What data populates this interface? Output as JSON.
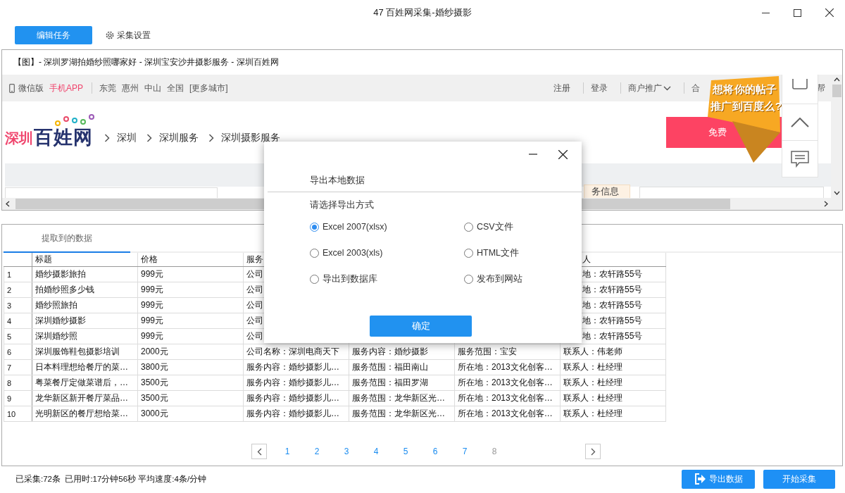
{
  "window": {
    "title": "47 百姓网采集-婚纱摄影"
  },
  "toolbar": {
    "buttons": [
      {
        "label": "编辑任务",
        "kind": "primary"
      },
      {
        "label": "采集设置",
        "kind": "settings"
      }
    ]
  },
  "browser": {
    "page_title": "【图】- 深圳罗湖拍婚纱照哪家好 - 深圳宝安沙井摄影服务 - 深圳百姓网",
    "top_bar": {
      "left_links": [
        {
          "label": "微信版",
          "kind": "phone"
        },
        {
          "label": "手机APP",
          "kind": "highlight"
        }
      ],
      "cities": [
        "东莞",
        "惠州",
        "中山",
        "全国",
        "[更多城市]"
      ],
      "right_links": [
        {
          "label": "注册",
          "kind": "link"
        },
        {
          "label": "登录",
          "kind": "link"
        },
        {
          "label": "商户推广",
          "kind": "dropdown"
        },
        {
          "label": "合",
          "kind": "link"
        },
        {
          "label": "帮",
          "kind": "link"
        }
      ]
    },
    "logo": {
      "city": "深圳",
      "name": "百姓网"
    },
    "breadcrumb": [
      "深圳",
      "深圳服务",
      "深圳摄影服务"
    ],
    "post_button": "免费",
    "ad": {
      "lines": [
        "想将你的帖子",
        "推广到百度么?"
      ]
    },
    "tab_fragment": "务信息"
  },
  "data_panel": {
    "tabs": [
      {
        "label": "提取到的数据",
        "selected": true
      }
    ],
    "table": {
      "columns": [
        "标题",
        "价格",
        "服务",
        "人"
      ],
      "rows": [
        {
          "number": "1",
          "kind": "covered",
          "cells": [
            "婚纱摄影旅拍",
            "999元",
            "公司",
            "地：农轩路55号"
          ]
        },
        {
          "number": "2",
          "kind": "covered",
          "cells": [
            "拍婚纱照多少钱",
            "999元",
            "公司",
            "地：农轩路55号"
          ]
        },
        {
          "number": "3",
          "kind": "covered",
          "cells": [
            "婚纱照旅拍",
            "999元",
            "公司",
            "地：农轩路55号"
          ]
        },
        {
          "number": "4",
          "kind": "covered",
          "cells": [
            "深圳婚纱摄影",
            "999元",
            "公司",
            "地：农轩路55号"
          ]
        },
        {
          "number": "5",
          "kind": "covered",
          "cells": [
            "深圳婚纱照",
            "999元",
            "公司",
            "地：农轩路55号"
          ]
        },
        {
          "number": "6",
          "kind": "full",
          "cells": [
            "深圳服饰鞋包摄影培训",
            "2000元",
            "公司名称：深圳电商天下",
            "服务内容：婚纱摄影",
            "服务范围：宝安",
            "联系人：伟老师"
          ]
        },
        {
          "number": "7",
          "kind": "full",
          "cells": [
            "日本料理想给餐厅的菜…",
            "3800元",
            "服务内容：婚纱摄影儿…",
            "服务范围：福田南山",
            "所在地：2013文化创客…",
            "联系人：杜经理"
          ]
        },
        {
          "number": "8",
          "kind": "full",
          "cells": [
            "粤菜餐厅定做菜谱后，…",
            "3500元",
            "服务内容：婚纱摄影儿…",
            "服务范围：福田罗湖",
            "所在地：2013文化创客…",
            "联系人：杜经理"
          ]
        },
        {
          "number": "9",
          "kind": "full",
          "cells": [
            "龙华新区新开餐厅菜品…",
            "3500元",
            "服务内容：婚纱摄影儿…",
            "服务范围：龙华新区光…",
            "所在地：2013文化创客…",
            "联系人：杜经理"
          ]
        },
        {
          "number": "10",
          "kind": "full",
          "cells": [
            "光明新区的餐厅想给菜…",
            "3000元",
            "服务内容：婚纱摄影儿…",
            "服务范围：龙华新区光…",
            "所在地：2013文化创客…",
            "联系人：杜经理"
          ]
        }
      ]
    },
    "pagination": {
      "pages": [
        {
          "label": "1",
          "selected": false
        },
        {
          "label": "2",
          "selected": false
        },
        {
          "label": "3",
          "selected": false
        },
        {
          "label": "4",
          "selected": false
        },
        {
          "label": "5",
          "selected": false
        },
        {
          "label": "6",
          "selected": false
        },
        {
          "label": "7",
          "selected": false
        },
        {
          "label": "8",
          "selected": true
        }
      ]
    }
  },
  "dialog": {
    "title": "导出本地数据",
    "prompt": "请选择导出方式",
    "options": [
      {
        "label": "Excel 2007(xlsx)",
        "selected": true
      },
      {
        "label": "CSV文件",
        "selected": false
      },
      {
        "label": "Excel 2003(xls)",
        "selected": false
      },
      {
        "label": "HTML文件",
        "selected": false
      },
      {
        "label": "导出到数据库",
        "selected": false
      },
      {
        "label": "发布到网站",
        "selected": false
      }
    ],
    "button": "确定"
  },
  "status_bar": {
    "text": "已采集:72条  已用时:17分钟56秒 平均速度:4条/分钟",
    "buttons": [
      {
        "label": "导出数据",
        "kind": "export"
      },
      {
        "label": "开始采集",
        "kind": "start"
      }
    ]
  }
}
